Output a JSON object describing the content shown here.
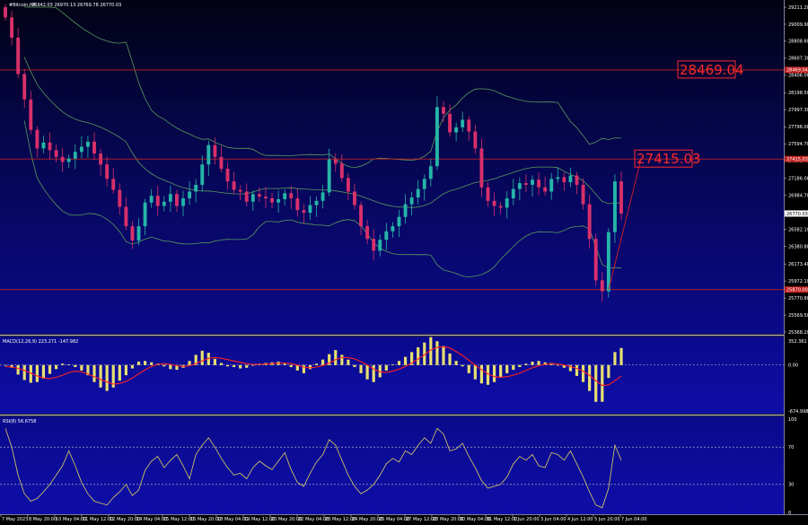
{
  "chart_data": {
    "type": "candlestick",
    "symbol_header": "#Bitcoin,H4",
    "ohlc_header": "26942.03 26970.13 26769.78 26770.03",
    "price_ticks": [
      "29211.20",
      "29009.90",
      "28808.60",
      "28607.30",
      "28406.00",
      "28198.50",
      "27997.30",
      "27796.00",
      "27594.70",
      "27393.40",
      "27186.00",
      "26984.70",
      "26783.40",
      "26582.10",
      "26380.80",
      "26173.40",
      "25972.10",
      "25770.80",
      "25569.50",
      "25368.20"
    ],
    "ylim": [
      25368.2,
      29211.2
    ],
    "levels": [
      {
        "value": 28469.04,
        "label": "28469.04",
        "tag": "28469.04",
        "color": "#c02020"
      },
      {
        "value": 27415.03,
        "label": "27415.03",
        "tag": "27415.03",
        "color": "#c02020"
      },
      {
        "value": 25870.0,
        "label": "",
        "tag": "25870.00",
        "color": "#c02020"
      }
    ],
    "current_price_tag": "26770.03",
    "date_ticks": [
      "7 May 2023",
      "8 May 20:00",
      "10 May 04:00",
      "11 May 12:00",
      "12 May 20:00",
      "14 May 04:00",
      "15 May 12:00",
      "16 May 20:00",
      "18 May 04:00",
      "19 May 12:00",
      "20 May 20:00",
      "22 May 04:00",
      "23 May 12:00",
      "24 May 20:00",
      "26 May 04:00",
      "27 May 12:00",
      "28 May 20:00",
      "30 May 04:00",
      "31 May 12:00",
      "1 Jun 20:00",
      "3 Jun 04:00",
      "4 Jun 12:00",
      "5 Jun 20:00",
      "7 Jun 04:00"
    ],
    "close": [
      29090,
      28850,
      28420,
      28120,
      27760,
      27540,
      27610,
      27520,
      27440,
      27380,
      27420,
      27500,
      27560,
      27620,
      27480,
      27350,
      27180,
      27050,
      26850,
      26620,
      26450,
      26620,
      26900,
      26980,
      26860,
      26910,
      27000,
      26860,
      26950,
      27030,
      27110,
      27350,
      27580,
      27440,
      27300,
      27150,
      27050,
      27030,
      26910,
      27000,
      26970,
      26950,
      26900,
      26940,
      27010,
      26950,
      26810,
      26780,
      26870,
      26920,
      27020,
      27410,
      27360,
      27190,
      27030,
      26870,
      26620,
      26470,
      26330,
      26460,
      26560,
      26620,
      26730,
      26880,
      26960,
      27060,
      27180,
      27330,
      28030,
      27950,
      27730,
      27790,
      27880,
      27740,
      27540,
      27080,
      26920,
      26860,
      26840,
      26950,
      27060,
      27130,
      27110,
      27170,
      27080,
      27030,
      27180,
      27200,
      27140,
      27220,
      27110,
      26880,
      26470,
      25980,
      25850,
      26550,
      27150,
      26770
    ],
    "macd": {
      "title": "MACD(12,26,9) 223.271 -147.982",
      "ticks": [
        "352.361",
        "0.00",
        "-674.998"
      ],
      "ylim": [
        -674.998,
        352.361
      ],
      "histogram": [
        -10,
        -40,
        -140,
        -220,
        -260,
        -250,
        -200,
        -130,
        -60,
        20,
        10,
        -30,
        -80,
        -150,
        -250,
        -330,
        -380,
        -330,
        -230,
        -150,
        -50,
        50,
        60,
        40,
        20,
        -20,
        -60,
        -70,
        -40,
        60,
        150,
        210,
        180,
        90,
        30,
        -20,
        -30,
        -50,
        -40,
        -10,
        20,
        30,
        40,
        50,
        20,
        -30,
        -80,
        -120,
        -60,
        20,
        80,
        160,
        220,
        150,
        80,
        -30,
        -120,
        -210,
        -250,
        -180,
        -80,
        10,
        60,
        120,
        190,
        260,
        330,
        410,
        350,
        280,
        170,
        60,
        -20,
        -120,
        -210,
        -270,
        -290,
        -250,
        -180,
        -120,
        -70,
        -30,
        20,
        50,
        60,
        40,
        30,
        -10,
        -40,
        -90,
        -160,
        -250,
        -380,
        -540,
        -540,
        -190,
        190,
        250
      ],
      "signal": [
        -20,
        -30,
        -50,
        -80,
        -120,
        -160,
        -190,
        -200,
        -180,
        -150,
        -110,
        -90,
        -100,
        -130,
        -170,
        -210,
        -250,
        -280,
        -270,
        -240,
        -190,
        -130,
        -70,
        -20,
        10,
        20,
        10,
        -10,
        -20,
        -10,
        20,
        60,
        100,
        110,
        100,
        80,
        60,
        40,
        20,
        10,
        10,
        15,
        20,
        30,
        30,
        20,
        0,
        -30,
        -40,
        -30,
        -10,
        30,
        80,
        110,
        110,
        90,
        50,
        0,
        -60,
        -100,
        -110,
        -90,
        -60,
        -20,
        30,
        90,
        150,
        220,
        260,
        270,
        250,
        200,
        140,
        70,
        0,
        -70,
        -130,
        -170,
        -180,
        -170,
        -150,
        -120,
        -80,
        -40,
        -10,
        10,
        20,
        15,
        0,
        -20,
        -50,
        -90,
        -150,
        -230,
        -300,
        -290,
        -230,
        -160
      ]
    },
    "rsi": {
      "title": "RSI(8) 56.6758",
      "ticks": [
        "100",
        "70",
        "30",
        "0"
      ],
      "levels": [
        70,
        30
      ],
      "values": [
        90,
        70,
        40,
        20,
        12,
        15,
        22,
        30,
        40,
        50,
        66,
        50,
        32,
        20,
        12,
        10,
        8,
        16,
        22,
        30,
        18,
        24,
        45,
        55,
        60,
        48,
        56,
        62,
        50,
        36,
        62,
        72,
        80,
        70,
        58,
        48,
        40,
        42,
        36,
        48,
        55,
        50,
        46,
        55,
        64,
        46,
        32,
        28,
        42,
        54,
        62,
        78,
        72,
        56,
        40,
        28,
        20,
        24,
        30,
        40,
        52,
        58,
        54,
        66,
        62,
        72,
        80,
        74,
        90,
        84,
        66,
        68,
        74,
        60,
        48,
        34,
        26,
        28,
        30,
        38,
        52,
        60,
        56,
        62,
        50,
        48,
        64,
        62,
        56,
        66,
        52,
        38,
        22,
        8,
        5,
        26,
        72,
        56
      ]
    }
  }
}
